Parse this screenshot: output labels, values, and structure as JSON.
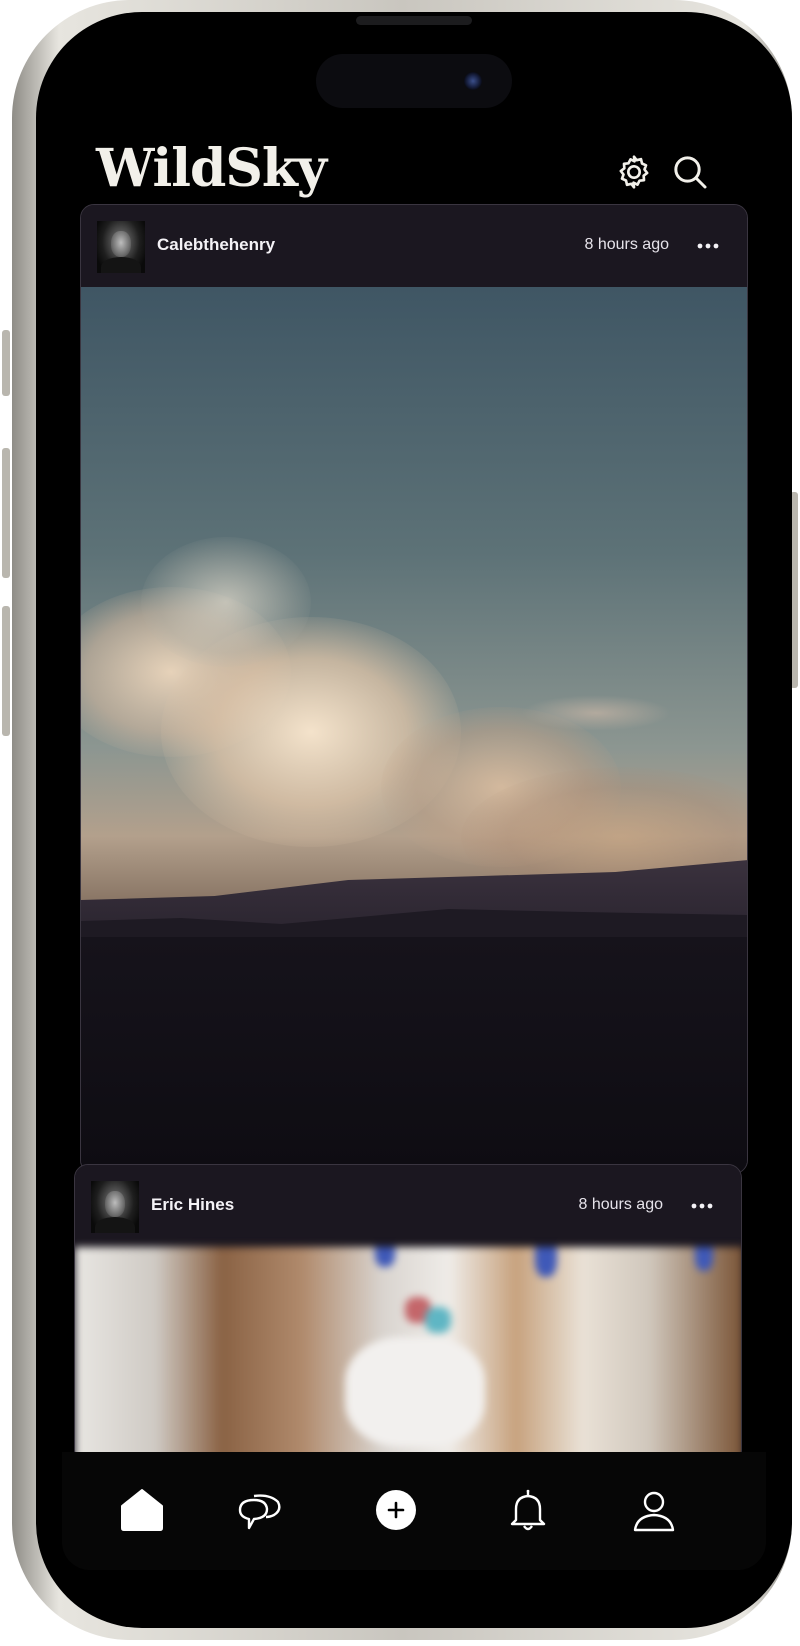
{
  "app": {
    "logo_text": "WildSky"
  },
  "header": {
    "icons": [
      "gear-icon",
      "search-icon"
    ]
  },
  "posts": [
    {
      "username": "Calebthehenry",
      "time": "8 hours ago",
      "media": "sky-clouds-photo"
    },
    {
      "username": "Eric Hines",
      "time": "8 hours ago",
      "media": "interior-blurred-photo"
    }
  ],
  "tabbar": {
    "items": [
      "home-icon",
      "chat-icon",
      "add-icon",
      "bell-icon",
      "profile-icon"
    ]
  },
  "colors": {
    "background": "#000000",
    "card": "#1b1720",
    "text": "#f4f2f6"
  }
}
